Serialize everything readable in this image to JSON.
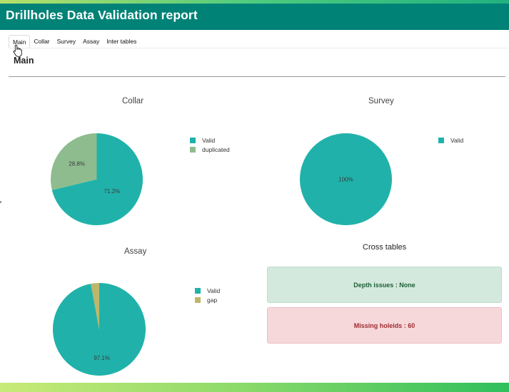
{
  "header": {
    "title": "Drillholes Data Validation report"
  },
  "tabs": [
    {
      "label": "Main"
    },
    {
      "label": "Collar"
    },
    {
      "label": "Survey"
    },
    {
      "label": "Assay"
    },
    {
      "label": "Inter tables"
    }
  ],
  "main": {
    "section_title": "Main"
  },
  "colors": {
    "header": "#008277",
    "valid": "#20b2aa",
    "duplicated": "#8fbc8f",
    "gap": "#bdb76b"
  },
  "charts": {
    "collar": {
      "title": "Collar",
      "legend": [
        {
          "label": "Valid",
          "color": "#20b2aa"
        },
        {
          "label": "duplicated",
          "color": "#8fbc8f"
        }
      ],
      "labels": [
        "71.2%",
        "28.8%"
      ]
    },
    "survey": {
      "title": "Survey",
      "legend": [
        {
          "label": "Valid",
          "color": "#20b2aa"
        }
      ],
      "labels": [
        "100%"
      ]
    },
    "assay": {
      "title": "Assay",
      "legend": [
        {
          "label": "Valid",
          "color": "#20b2aa"
        },
        {
          "label": "gap",
          "color": "#bdb76b"
        }
      ],
      "labels": [
        "97.1%"
      ]
    }
  },
  "chart_data": [
    {
      "type": "pie",
      "title": "Collar",
      "categories": [
        "Valid",
        "duplicated"
      ],
      "values": [
        71.2,
        28.8
      ],
      "legend": "right"
    },
    {
      "type": "pie",
      "title": "Survey",
      "categories": [
        "Valid"
      ],
      "values": [
        100
      ],
      "legend": "right"
    },
    {
      "type": "pie",
      "title": "Assay",
      "categories": [
        "Valid",
        "gap"
      ],
      "values": [
        97.1,
        2.9
      ],
      "legend": "right"
    }
  ],
  "cross_tables": {
    "title": "Cross tables",
    "depth_issues": "Depth issues : None",
    "missing_holeids": "Missing holeids : 60"
  }
}
